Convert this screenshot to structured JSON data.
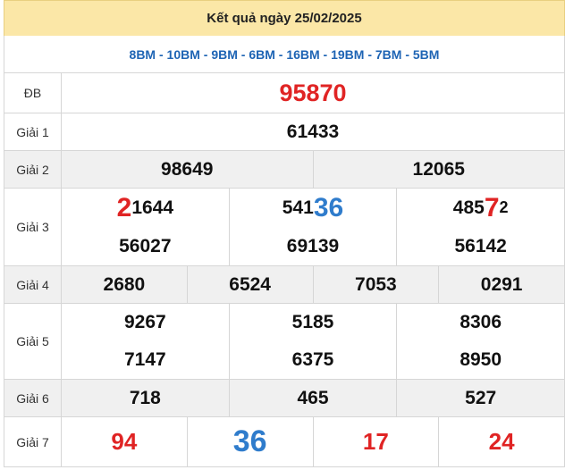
{
  "header": {
    "title": "Kết quả ngày 25/02/2025"
  },
  "codes": "8BM - 10BM - 9BM - 6BM - 16BM - 19BM - 7BM - 5BM",
  "prizes": {
    "db": {
      "label": "ĐB",
      "value": "95870"
    },
    "g1": {
      "label": "Giải 1",
      "values": [
        "61433"
      ]
    },
    "g2": {
      "label": "Giải 2",
      "values": [
        "98649",
        "12065"
      ]
    },
    "g3": {
      "label": "Giải 3",
      "row1": [
        {
          "hl": "2",
          "rest": "1644"
        },
        {
          "pre": "541",
          "hl": "36"
        },
        {
          "pre": "485",
          "hl": "7",
          "post": "2"
        }
      ],
      "row2": [
        "56027",
        "69139",
        "56142"
      ]
    },
    "g4": {
      "label": "Giải 4",
      "values": [
        "2680",
        "6524",
        "7053",
        "0291"
      ]
    },
    "g5": {
      "label": "Giải 5",
      "row1": [
        "9267",
        "5185",
        "8306"
      ],
      "row2": [
        "7147",
        "6375",
        "8950"
      ]
    },
    "g6": {
      "label": "Giải 6",
      "values": [
        "718",
        "465",
        "527"
      ]
    },
    "g7": {
      "label": "Giải 7",
      "values": [
        "94",
        "36",
        "17",
        "24"
      ]
    }
  },
  "colors": {
    "header_bg": "#fbe7a7",
    "code_text": "#1e64b4",
    "red": "#e02424",
    "blue": "#2f7ccc",
    "alt_row": "#f0f0f0"
  }
}
